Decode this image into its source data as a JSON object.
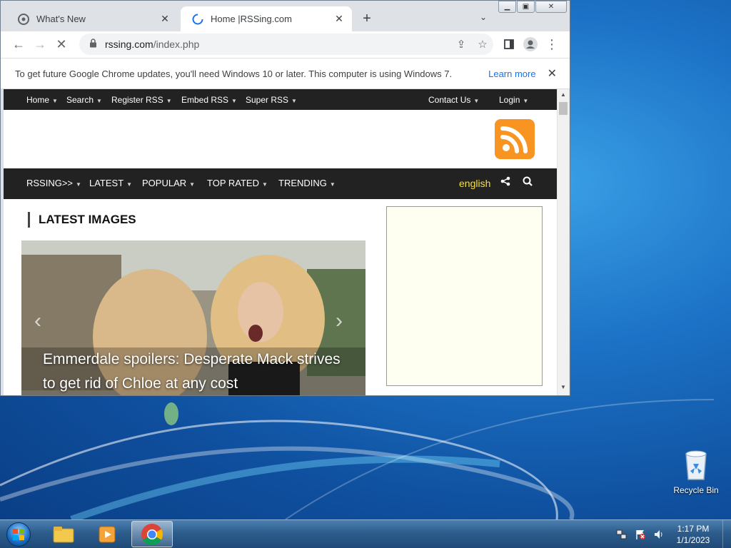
{
  "browser": {
    "tabs": [
      {
        "title": "What's New",
        "active": false
      },
      {
        "title": "Home |RSSing.com",
        "active": true
      }
    ],
    "url_host": "rssing.com",
    "url_path": "/index.php",
    "infobar": {
      "message": "To get future Google Chrome updates, you'll need Windows 10 or later. This computer is using Windows 7.",
      "learn_more": "Learn more"
    }
  },
  "site": {
    "topnav": [
      "Home",
      "Search",
      "Register RSS",
      "Embed RSS",
      "Super RSS"
    ],
    "topnav_right": [
      "Contact Us",
      "Login"
    ],
    "mainnav": [
      "RSSING>>",
      "LATEST",
      "POPULAR",
      "TOP RATED",
      "TRENDING"
    ],
    "language": "english",
    "latest_heading": "LATEST IMAGES",
    "slide_title": "Emmerdale spoilers: Desperate Mack strives to get rid of Chloe at any cost",
    "accent_color": "#f79422"
  },
  "desktop": {
    "recycle_bin_label": "Recycle Bin"
  },
  "taskbar": {
    "time": "1:17 PM",
    "date": "1/1/2023"
  }
}
